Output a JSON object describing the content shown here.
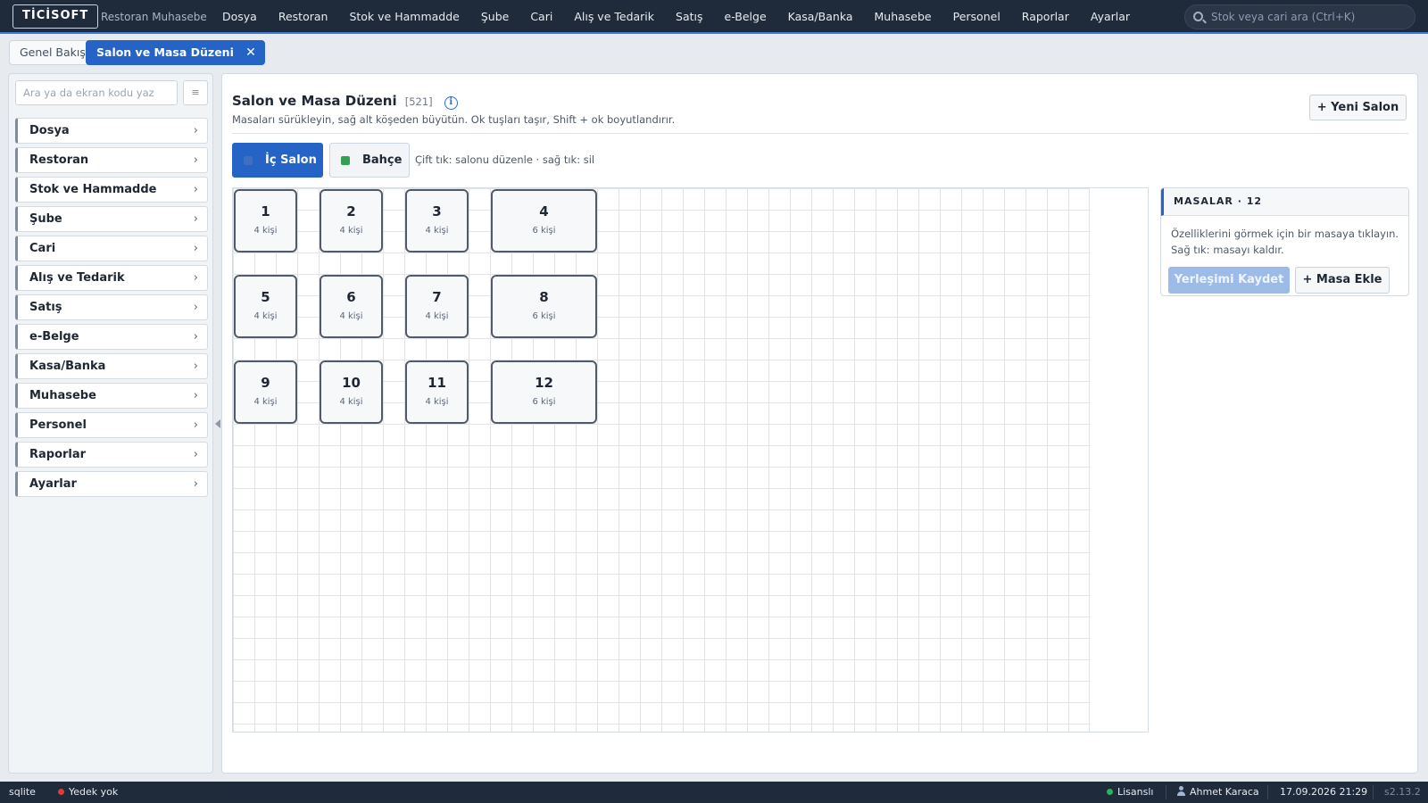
{
  "app": {
    "logo": "TİCİSOFT",
    "subtitle": "Restoran Muhasebe",
    "nav": [
      "Dosya",
      "Restoran",
      "Stok ve Hammadde",
      "Şube",
      "Cari",
      "Alış ve Tedarik",
      "Satış",
      "e-Belge",
      "Kasa/Banka",
      "Muhasebe",
      "Personel",
      "Raporlar",
      "Ayarlar"
    ],
    "search_placeholder": "Stok veya cari ara (Ctrl+K)"
  },
  "tabs": {
    "overview": "Genel Bakış",
    "active": "Salon ve Masa Düzeni",
    "close": "✕"
  },
  "sidebar": {
    "search_placeholder": "Ara ya da ekran kodu yaz",
    "menu_glyph": "≡",
    "items": [
      "Dosya",
      "Restoran",
      "Stok ve Hammadde",
      "Şube",
      "Cari",
      "Alış ve Tedarik",
      "Satış",
      "e-Belge",
      "Kasa/Banka",
      "Muhasebe",
      "Personel",
      "Raporlar",
      "Ayarlar"
    ],
    "chevron": "›"
  },
  "page": {
    "title": "Salon ve Masa Düzeni",
    "code": "[521]",
    "info": "i",
    "hint": "Masaları sürükleyin, sağ alt köşeden büyütün. Ok tuşları taşır, Shift + ok boyutlandırır.",
    "new_salon": "+ Yeni Salon",
    "rooms": [
      {
        "label": "İç Salon",
        "color": "#3e6fc0"
      },
      {
        "label": "Bahçe",
        "color": "#35a053"
      }
    ],
    "room_hint": "Çift tık: salonu düzenle · sağ tık: sil"
  },
  "tables": [
    {
      "number": "1",
      "capacity": "4 kişi",
      "col": 0,
      "row": 0,
      "wide": false
    },
    {
      "number": "2",
      "capacity": "4 kişi",
      "col": 1,
      "row": 0,
      "wide": false
    },
    {
      "number": "3",
      "capacity": "4 kişi",
      "col": 2,
      "row": 0,
      "wide": false
    },
    {
      "number": "4",
      "capacity": "6 kişi",
      "col": 3,
      "row": 0,
      "wide": true
    },
    {
      "number": "5",
      "capacity": "4 kişi",
      "col": 0,
      "row": 1,
      "wide": false
    },
    {
      "number": "6",
      "capacity": "4 kişi",
      "col": 1,
      "row": 1,
      "wide": false
    },
    {
      "number": "7",
      "capacity": "4 kişi",
      "col": 2,
      "row": 1,
      "wide": false
    },
    {
      "number": "8",
      "capacity": "6 kişi",
      "col": 3,
      "row": 1,
      "wide": true
    },
    {
      "number": "9",
      "capacity": "4 kişi",
      "col": 0,
      "row": 2,
      "wide": false
    },
    {
      "number": "10",
      "capacity": "4 kişi",
      "col": 1,
      "row": 2,
      "wide": false
    },
    {
      "number": "11",
      "capacity": "4 kişi",
      "col": 2,
      "row": 2,
      "wide": false
    },
    {
      "number": "12",
      "capacity": "6 kişi",
      "col": 3,
      "row": 2,
      "wide": true
    }
  ],
  "props": {
    "header": "MASALAR · 12",
    "text": "Özelliklerini görmek için bir masaya tıklayın. Sağ tık: masayı kaldır.",
    "save": "Yerleşimi Kaydet",
    "add": "+ Masa Ekle"
  },
  "status": {
    "db": "sqlite",
    "backup": "Yedek yok",
    "backup_color": "#e03b3b",
    "license": "Lisanslı",
    "license_color": "#2fb35a",
    "user": "Ahmet Karaca",
    "datetime": "17.09.2026 21:29",
    "version": "s2.13.2"
  }
}
